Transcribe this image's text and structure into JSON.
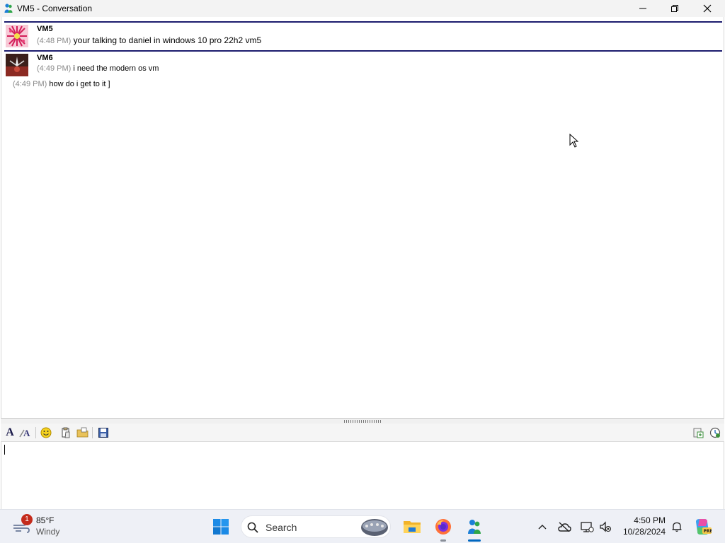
{
  "window": {
    "title": "VM5 - Conversation"
  },
  "conversation": {
    "messages": [
      {
        "sender": "VM5",
        "lines": [
          {
            "time": "(4:48 PM)",
            "text": "your talking to daniel in windows 10 pro 22h2 vm5"
          }
        ]
      },
      {
        "sender": "VM6",
        "lines": [
          {
            "time": "(4:49 PM)",
            "text": "i need the modern os vm"
          },
          {
            "time": "(4:49 PM)",
            "text": "how do i get to it ]"
          }
        ]
      }
    ]
  },
  "compose": {
    "value": ""
  },
  "taskbar": {
    "weather": {
      "temp": "85°F",
      "condition": "Windy",
      "badge": "1"
    },
    "search": {
      "label": "Search"
    },
    "clock": {
      "time": "4:50 PM",
      "date": "10/28/2024"
    }
  },
  "colors": {
    "highlight_border": "#1c1c6e",
    "timestamp": "#8a8a8a",
    "taskbar_bg": "#eef0f6",
    "accent": "#0067c0"
  }
}
